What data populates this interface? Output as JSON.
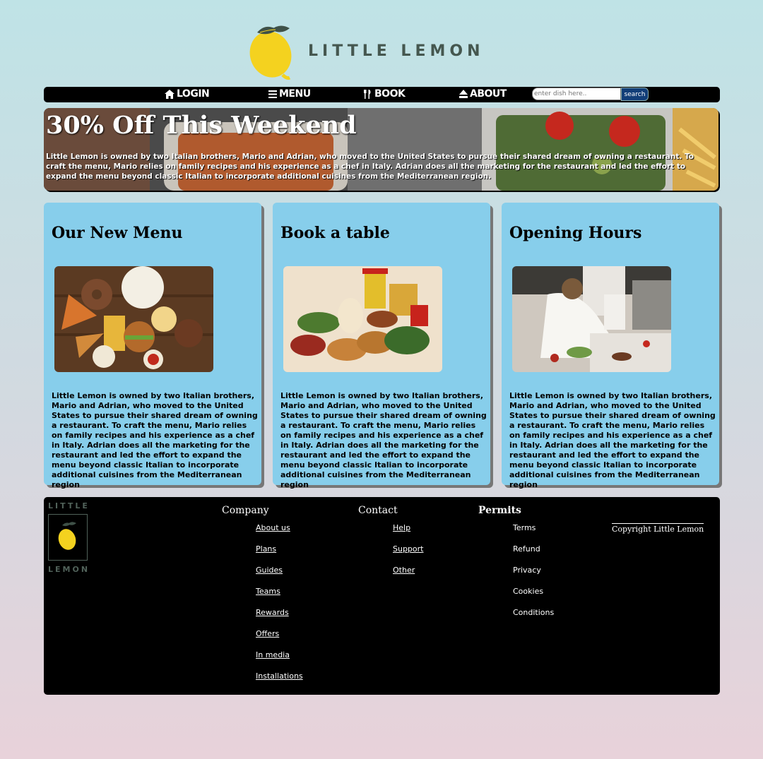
{
  "brand": {
    "name": "LITTLE LEMON"
  },
  "nav": {
    "items": [
      {
        "label": "LOGIN",
        "icon": "home-icon"
      },
      {
        "label": "MENU",
        "icon": "menu-icon"
      },
      {
        "label": "BOOK",
        "icon": "utensils-icon"
      },
      {
        "label": "ABOUT",
        "icon": "eject-icon"
      }
    ],
    "search": {
      "placeholder": "enter dish here..",
      "button": "search"
    }
  },
  "hero": {
    "title": "30% Off This Weekend",
    "text": "Little Lemon is owned by two Italian brothers, Mario and Adrian, who moved to the United States to pursue their shared dream of owning a restaurant. To craft the menu, Mario relies on family recipes and his experience as a chef in Italy. Adrian does all the marketing for the restaurant and led the effort to expand the menu beyond classic Italian to incorporate additional cuisines from the Mediterranean region."
  },
  "cards": [
    {
      "title": "Our New Menu",
      "text": "Little Lemon is owned by two Italian brothers, Mario and Adrian, who moved to the United States to pursue their shared dream of owning a restaurant. To craft the menu, Mario relies on family recipes and his experience as a chef in Italy. Adrian does all the marketing for the restaurant and led the effort to expand the menu beyond classic Italian to incorporate additional cuisines from the Mediterranean region"
    },
    {
      "title": "Book a table",
      "text": "Little Lemon is owned by two Italian brothers, Mario and Adrian, who moved to the United States to pursue their shared dream of owning a restaurant. To craft the menu, Mario relies on family recipes and his experience as a chef in Italy. Adrian does all the marketing for the restaurant and led the effort to expand the menu beyond classic Italian to incorporate additional cuisines from the Mediterranean region"
    },
    {
      "title": "Opening Hours",
      "text": "Little Lemon is owned by two Italian brothers, Mario and Adrian, who moved to the United States to pursue their shared dream of owning a restaurant. To craft the menu, Mario relies on family recipes and his experience as a chef in Italy. Adrian does all the marketing for the restaurant and led the effort to expand the menu beyond classic Italian to incorporate additional cuisines from the Mediterranean region"
    }
  ],
  "footer": {
    "logo_top": "LITTLE",
    "logo_bottom": "LEMON",
    "columns": [
      {
        "heading": "Company",
        "links": [
          "About us",
          "Plans",
          "Guides",
          "Teams",
          "Rewards",
          "Offers",
          "In media",
          "Installations"
        ]
      },
      {
        "heading": "Contact",
        "links": [
          "Help",
          "Support",
          "Other"
        ]
      },
      {
        "heading": "Permits",
        "links": [
          "Terms",
          "Refund",
          "Privacy",
          "Cookies",
          "Conditions"
        ]
      }
    ],
    "copyright": "Copyright Little Lemon"
  },
  "colors": {
    "card_bg": "#87ceeb",
    "nav_bg": "#000000",
    "lemon": "#f4d21f",
    "leaf": "#45574f"
  }
}
